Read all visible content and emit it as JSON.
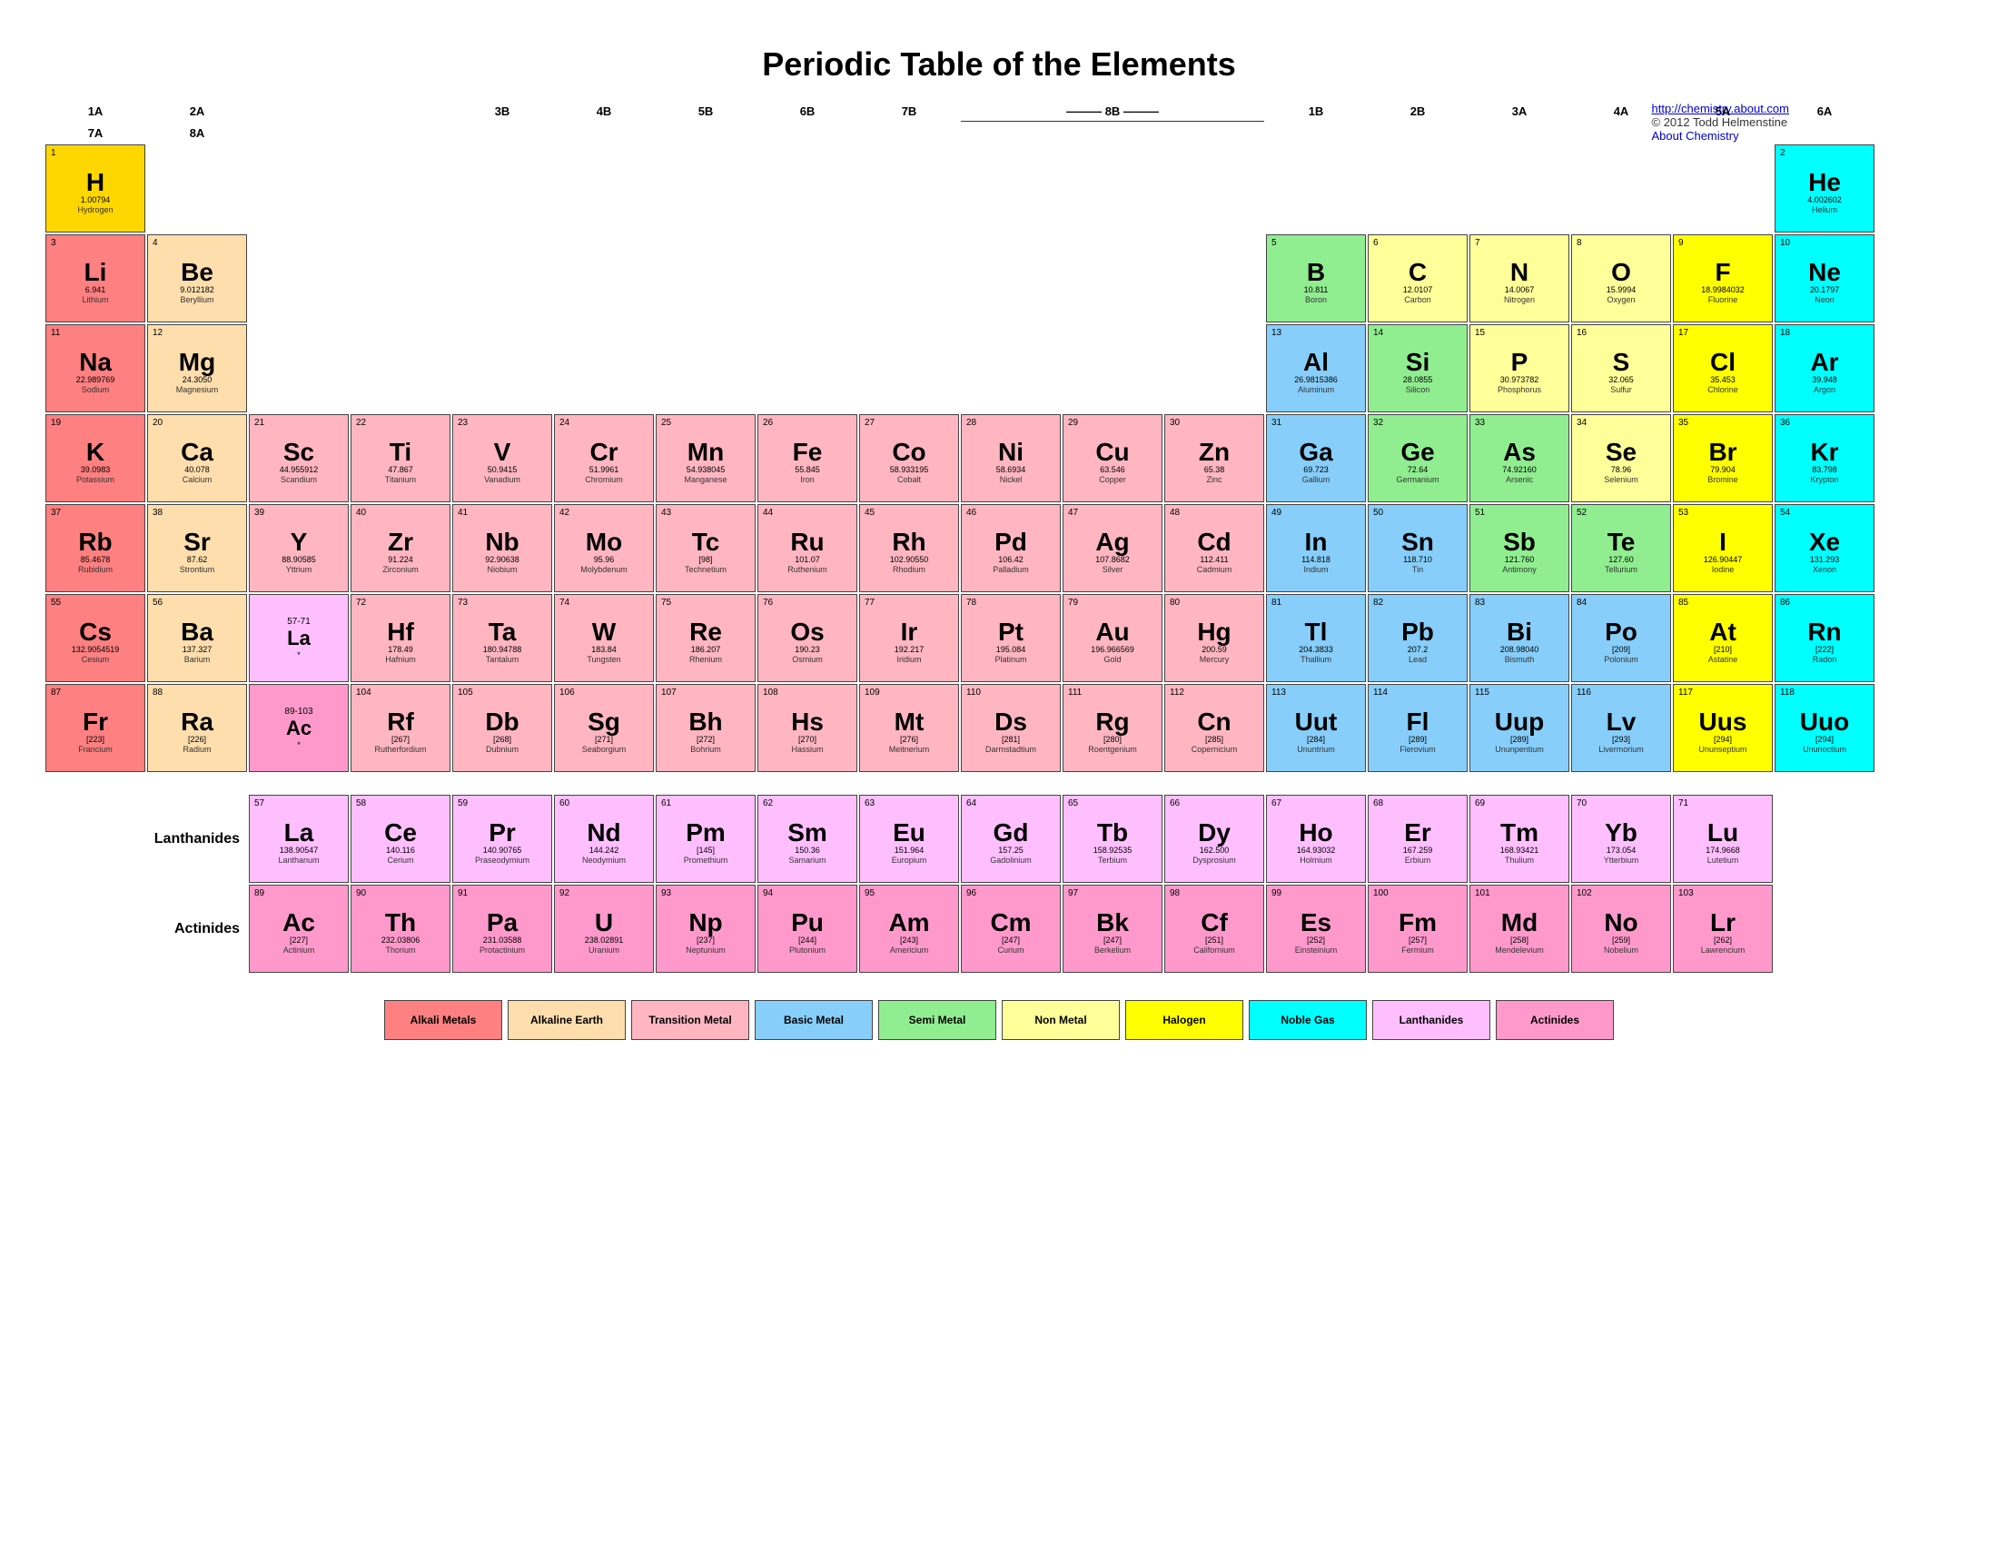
{
  "title": "Periodic Table of the Elements",
  "credit": {
    "url": "http://chemistry.about.com",
    "url_text": "http://chemistry.about.com",
    "copy": "© 2012 Todd Helmenstine",
    "site": "About Chemistry"
  },
  "col_headers": [
    "1A",
    "2A",
    "",
    "",
    "3B",
    "4B",
    "5B",
    "6B",
    "7B",
    "8B",
    "",
    "",
    "1B",
    "2B",
    "3A",
    "4A",
    "5A",
    "6A",
    "7A",
    "8A"
  ],
  "elements": [
    {
      "num": 1,
      "sym": "H",
      "mass": "1.00794",
      "name": "Hydrogen",
      "type": "hydrogen-cell",
      "row": 1,
      "col": 1
    },
    {
      "num": 2,
      "sym": "He",
      "mass": "4.002602",
      "name": "Helium",
      "type": "noble",
      "row": 1,
      "col": 18
    },
    {
      "num": 3,
      "sym": "Li",
      "mass": "6.941",
      "name": "Lithium",
      "type": "alkali",
      "row": 2,
      "col": 1
    },
    {
      "num": 4,
      "sym": "Be",
      "mass": "9.012182",
      "name": "Beryllium",
      "type": "alkaline",
      "row": 2,
      "col": 2
    },
    {
      "num": 5,
      "sym": "B",
      "mass": "10.811",
      "name": "Boron",
      "type": "semi",
      "row": 2,
      "col": 13
    },
    {
      "num": 6,
      "sym": "C",
      "mass": "12.0107",
      "name": "Carbon",
      "type": "nonmetal",
      "row": 2,
      "col": 14
    },
    {
      "num": 7,
      "sym": "N",
      "mass": "14.0067",
      "name": "Nitrogen",
      "type": "nonmetal",
      "row": 2,
      "col": 15
    },
    {
      "num": 8,
      "sym": "O",
      "mass": "15.9994",
      "name": "Oxygen",
      "type": "nonmetal",
      "row": 2,
      "col": 16
    },
    {
      "num": 9,
      "sym": "F",
      "mass": "18.9984032",
      "name": "Fluorine",
      "type": "halogen",
      "row": 2,
      "col": 17
    },
    {
      "num": 10,
      "sym": "Ne",
      "mass": "20.1797",
      "name": "Neon",
      "type": "noble",
      "row": 2,
      "col": 18
    },
    {
      "num": 11,
      "sym": "Na",
      "mass": "22.989769",
      "name": "Sodium",
      "type": "alkali",
      "row": 3,
      "col": 1
    },
    {
      "num": 12,
      "sym": "Mg",
      "mass": "24.3050",
      "name": "Magnesium",
      "type": "alkaline",
      "row": 3,
      "col": 2
    },
    {
      "num": 13,
      "sym": "Al",
      "mass": "26.9815386",
      "name": "Aluminum",
      "type": "basic-metal",
      "row": 3,
      "col": 13
    },
    {
      "num": 14,
      "sym": "Si",
      "mass": "28.0855",
      "name": "Silicon",
      "type": "semi",
      "row": 3,
      "col": 14
    },
    {
      "num": 15,
      "sym": "P",
      "mass": "30.973782",
      "name": "Phosphorus",
      "type": "nonmetal",
      "row": 3,
      "col": 15
    },
    {
      "num": 16,
      "sym": "S",
      "mass": "32.065",
      "name": "Sulfur",
      "type": "nonmetal",
      "row": 3,
      "col": 16
    },
    {
      "num": 17,
      "sym": "Cl",
      "mass": "35.453",
      "name": "Chlorine",
      "type": "halogen",
      "row": 3,
      "col": 17
    },
    {
      "num": 18,
      "sym": "Ar",
      "mass": "39.948",
      "name": "Argon",
      "type": "noble",
      "row": 3,
      "col": 18
    },
    {
      "num": 19,
      "sym": "K",
      "mass": "39.0983",
      "name": "Potassium",
      "type": "alkali",
      "row": 4,
      "col": 1
    },
    {
      "num": 20,
      "sym": "Ca",
      "mass": "40.078",
      "name": "Calcium",
      "type": "alkaline",
      "row": 4,
      "col": 2
    },
    {
      "num": 21,
      "sym": "Sc",
      "mass": "44.955912",
      "name": "Scandium",
      "type": "transition",
      "row": 4,
      "col": 3
    },
    {
      "num": 22,
      "sym": "Ti",
      "mass": "47.867",
      "name": "Titanium",
      "type": "transition",
      "row": 4,
      "col": 4
    },
    {
      "num": 23,
      "sym": "V",
      "mass": "50.9415",
      "name": "Vanadium",
      "type": "transition",
      "row": 4,
      "col": 5
    },
    {
      "num": 24,
      "sym": "Cr",
      "mass": "51.9961",
      "name": "Chromium",
      "type": "transition",
      "row": 4,
      "col": 6
    },
    {
      "num": 25,
      "sym": "Mn",
      "mass": "54.938045",
      "name": "Manganese",
      "type": "transition",
      "row": 4,
      "col": 7
    },
    {
      "num": 26,
      "sym": "Fe",
      "mass": "55.845",
      "name": "Iron",
      "type": "transition",
      "row": 4,
      "col": 8
    },
    {
      "num": 27,
      "sym": "Co",
      "mass": "58.933195",
      "name": "Cobalt",
      "type": "transition",
      "row": 4,
      "col": 9
    },
    {
      "num": 28,
      "sym": "Ni",
      "mass": "58.6934",
      "name": "Nickel",
      "type": "transition",
      "row": 4,
      "col": 10
    },
    {
      "num": 29,
      "sym": "Cu",
      "mass": "63.546",
      "name": "Copper",
      "type": "transition",
      "row": 4,
      "col": 11
    },
    {
      "num": 30,
      "sym": "Zn",
      "mass": "65.38",
      "name": "Zinc",
      "type": "transition",
      "row": 4,
      "col": 12
    },
    {
      "num": 31,
      "sym": "Ga",
      "mass": "69.723",
      "name": "Gallium",
      "type": "basic-metal",
      "row": 4,
      "col": 13
    },
    {
      "num": 32,
      "sym": "Ge",
      "mass": "72.64",
      "name": "Germanium",
      "type": "semi",
      "row": 4,
      "col": 14
    },
    {
      "num": 33,
      "sym": "As",
      "mass": "74.92160",
      "name": "Arsenic",
      "type": "semi",
      "row": 4,
      "col": 15
    },
    {
      "num": 34,
      "sym": "Se",
      "mass": "78.96",
      "name": "Selenium",
      "type": "nonmetal",
      "row": 4,
      "col": 16
    },
    {
      "num": 35,
      "sym": "Br",
      "mass": "79.904",
      "name": "Bromine",
      "type": "halogen",
      "row": 4,
      "col": 17
    },
    {
      "num": 36,
      "sym": "Kr",
      "mass": "83.798",
      "name": "Krypton",
      "type": "noble",
      "row": 4,
      "col": 18
    },
    {
      "num": 37,
      "sym": "Rb",
      "mass": "85.4678",
      "name": "Rubidium",
      "type": "alkali",
      "row": 5,
      "col": 1
    },
    {
      "num": 38,
      "sym": "Sr",
      "mass": "87.62",
      "name": "Strontium",
      "type": "alkaline",
      "row": 5,
      "col": 2
    },
    {
      "num": 39,
      "sym": "Y",
      "mass": "88.90585",
      "name": "Yttrium",
      "type": "transition",
      "row": 5,
      "col": 3
    },
    {
      "num": 40,
      "sym": "Zr",
      "mass": "91.224",
      "name": "Zirconium",
      "type": "transition",
      "row": 5,
      "col": 4
    },
    {
      "num": 41,
      "sym": "Nb",
      "mass": "92.90638",
      "name": "Niobium",
      "type": "transition",
      "row": 5,
      "col": 5
    },
    {
      "num": 42,
      "sym": "Mo",
      "mass": "95.96",
      "name": "Molybdenum",
      "type": "transition",
      "row": 5,
      "col": 6
    },
    {
      "num": 43,
      "sym": "Tc",
      "mass": "[98]",
      "name": "Technetium",
      "type": "transition",
      "row": 5,
      "col": 7
    },
    {
      "num": 44,
      "sym": "Ru",
      "mass": "101.07",
      "name": "Ruthenium",
      "type": "transition",
      "row": 5,
      "col": 8
    },
    {
      "num": 45,
      "sym": "Rh",
      "mass": "102.90550",
      "name": "Rhodium",
      "type": "transition",
      "row": 5,
      "col": 9
    },
    {
      "num": 46,
      "sym": "Pd",
      "mass": "106.42",
      "name": "Palladium",
      "type": "transition",
      "row": 5,
      "col": 10
    },
    {
      "num": 47,
      "sym": "Ag",
      "mass": "107.8682",
      "name": "Silver",
      "type": "transition",
      "row": 5,
      "col": 11
    },
    {
      "num": 48,
      "sym": "Cd",
      "mass": "112.411",
      "name": "Cadmium",
      "type": "transition",
      "row": 5,
      "col": 12
    },
    {
      "num": 49,
      "sym": "In",
      "mass": "114.818",
      "name": "Indium",
      "type": "basic-metal",
      "row": 5,
      "col": 13
    },
    {
      "num": 50,
      "sym": "Sn",
      "mass": "118.710",
      "name": "Tin",
      "type": "basic-metal",
      "row": 5,
      "col": 14
    },
    {
      "num": 51,
      "sym": "Sb",
      "mass": "121.760",
      "name": "Antimony",
      "type": "semi",
      "row": 5,
      "col": 15
    },
    {
      "num": 52,
      "sym": "Te",
      "mass": "127.60",
      "name": "Tellurium",
      "type": "semi",
      "row": 5,
      "col": 16
    },
    {
      "num": 53,
      "sym": "I",
      "mass": "126.90447",
      "name": "Iodine",
      "type": "halogen",
      "row": 5,
      "col": 17
    },
    {
      "num": 54,
      "sym": "Xe",
      "mass": "131.293",
      "name": "Xenon",
      "type": "noble",
      "row": 5,
      "col": 18
    },
    {
      "num": 55,
      "sym": "Cs",
      "mass": "132.9054519",
      "name": "Cesium",
      "type": "alkali",
      "row": 6,
      "col": 1
    },
    {
      "num": 56,
      "sym": "Ba",
      "mass": "137.327",
      "name": "Barium",
      "type": "alkaline",
      "row": 6,
      "col": 2
    },
    {
      "num": 57,
      "sym": "La*",
      "mass": "138.90547",
      "name": "Lanthanum",
      "type": "lanthanide",
      "row": 6,
      "col": 3,
      "note": "57-71"
    },
    {
      "num": 72,
      "sym": "Hf",
      "mass": "178.49",
      "name": "Hafnium",
      "type": "transition",
      "row": 6,
      "col": 4
    },
    {
      "num": 73,
      "sym": "Ta",
      "mass": "180.94788",
      "name": "Tantalum",
      "type": "transition",
      "row": 6,
      "col": 5
    },
    {
      "num": 74,
      "sym": "W",
      "mass": "183.84",
      "name": "Tungsten",
      "type": "transition",
      "row": 6,
      "col": 6
    },
    {
      "num": 75,
      "sym": "Re",
      "mass": "186.207",
      "name": "Rhenium",
      "type": "transition",
      "row": 6,
      "col": 7
    },
    {
      "num": 76,
      "sym": "Os",
      "mass": "190.23",
      "name": "Osmium",
      "type": "transition",
      "row": 6,
      "col": 8
    },
    {
      "num": 77,
      "sym": "Ir",
      "mass": "192.217",
      "name": "Iridium",
      "type": "transition",
      "row": 6,
      "col": 9
    },
    {
      "num": 78,
      "sym": "Pt",
      "mass": "195.084",
      "name": "Platinum",
      "type": "transition",
      "row": 6,
      "col": 10
    },
    {
      "num": 79,
      "sym": "Au",
      "mass": "196.966569",
      "name": "Gold",
      "type": "transition",
      "row": 6,
      "col": 11
    },
    {
      "num": 80,
      "sym": "Hg",
      "mass": "200.59",
      "name": "Mercury",
      "type": "transition",
      "row": 6,
      "col": 12
    },
    {
      "num": 81,
      "sym": "Tl",
      "mass": "204.3833",
      "name": "Thallium",
      "type": "basic-metal",
      "row": 6,
      "col": 13
    },
    {
      "num": 82,
      "sym": "Pb",
      "mass": "207.2",
      "name": "Lead",
      "type": "basic-metal",
      "row": 6,
      "col": 14
    },
    {
      "num": 83,
      "sym": "Bi",
      "mass": "208.98040",
      "name": "Bismuth",
      "type": "basic-metal",
      "row": 6,
      "col": 15
    },
    {
      "num": 84,
      "sym": "Po",
      "mass": "[209]",
      "name": "Polonium",
      "type": "basic-metal",
      "row": 6,
      "col": 16
    },
    {
      "num": 85,
      "sym": "At",
      "mass": "[210]",
      "name": "Astatine",
      "type": "halogen",
      "row": 6,
      "col": 17
    },
    {
      "num": 86,
      "sym": "Rn",
      "mass": "[222]",
      "name": "Radon",
      "type": "noble",
      "row": 6,
      "col": 18
    },
    {
      "num": 87,
      "sym": "Fr",
      "mass": "[223]",
      "name": "Francium",
      "type": "alkali",
      "row": 7,
      "col": 1
    },
    {
      "num": 88,
      "sym": "Ra",
      "mass": "[226]",
      "name": "Radium",
      "type": "alkaline",
      "row": 7,
      "col": 2
    },
    {
      "num": 89,
      "sym": "Ac*",
      "mass": "[227]",
      "name": "Actinium",
      "type": "actinide",
      "row": 7,
      "col": 3,
      "note": "89-103"
    },
    {
      "num": 104,
      "sym": "Rf",
      "mass": "[267]",
      "name": "Rutherfordium",
      "type": "transition",
      "row": 7,
      "col": 4
    },
    {
      "num": 105,
      "sym": "Db",
      "mass": "[268]",
      "name": "Dubnium",
      "type": "transition",
      "row": 7,
      "col": 5
    },
    {
      "num": 106,
      "sym": "Sg",
      "mass": "[271]",
      "name": "Seaborgium",
      "type": "transition",
      "row": 7,
      "col": 6
    },
    {
      "num": 107,
      "sym": "Bh",
      "mass": "[272]",
      "name": "Bohrium",
      "type": "transition",
      "row": 7,
      "col": 7
    },
    {
      "num": 108,
      "sym": "Hs",
      "mass": "[270]",
      "name": "Hassium",
      "type": "transition",
      "row": 7,
      "col": 8
    },
    {
      "num": 109,
      "sym": "Mt",
      "mass": "[276]",
      "name": "Meitnerium",
      "type": "transition",
      "row": 7,
      "col": 9
    },
    {
      "num": 110,
      "sym": "Ds",
      "mass": "[281]",
      "name": "Darmstadtium",
      "type": "transition",
      "row": 7,
      "col": 10
    },
    {
      "num": 111,
      "sym": "Rg",
      "mass": "[280]",
      "name": "Roentgenium",
      "type": "transition",
      "row": 7,
      "col": 11
    },
    {
      "num": 112,
      "sym": "Cn",
      "mass": "[285]",
      "name": "Copernicium",
      "type": "transition",
      "row": 7,
      "col": 12
    },
    {
      "num": 113,
      "sym": "Uut",
      "mass": "[284]",
      "name": "Ununtrium",
      "type": "basic-metal",
      "row": 7,
      "col": 13
    },
    {
      "num": 114,
      "sym": "Fl",
      "mass": "[289]",
      "name": "Flerovium",
      "type": "basic-metal",
      "row": 7,
      "col": 14
    },
    {
      "num": 115,
      "sym": "Uup",
      "mass": "[289]",
      "name": "Ununpentium",
      "type": "basic-metal",
      "row": 7,
      "col": 15
    },
    {
      "num": 116,
      "sym": "Lv",
      "mass": "[293]",
      "name": "Livermorium",
      "type": "basic-metal",
      "row": 7,
      "col": 16
    },
    {
      "num": 117,
      "sym": "Uus",
      "mass": "[294]",
      "name": "Ununseptium",
      "type": "halogen",
      "row": 7,
      "col": 17
    },
    {
      "num": 118,
      "sym": "Uuo",
      "mass": "[294]",
      "name": "Ununoctium",
      "type": "noble",
      "row": 7,
      "col": 18
    }
  ],
  "lanthanides": [
    {
      "num": 57,
      "sym": "La",
      "mass": "138.90547",
      "name": "Lanthanum"
    },
    {
      "num": 58,
      "sym": "Ce",
      "mass": "140.116",
      "name": "Cerium"
    },
    {
      "num": 59,
      "sym": "Pr",
      "mass": "140.90765",
      "name": "Praseodymium"
    },
    {
      "num": 60,
      "sym": "Nd",
      "mass": "144.242",
      "name": "Neodymium"
    },
    {
      "num": 61,
      "sym": "Pm",
      "mass": "[145]",
      "name": "Promethium"
    },
    {
      "num": 62,
      "sym": "Sm",
      "mass": "150.36",
      "name": "Samarium"
    },
    {
      "num": 63,
      "sym": "Eu",
      "mass": "151.964",
      "name": "Europium"
    },
    {
      "num": 64,
      "sym": "Gd",
      "mass": "157.25",
      "name": "Gadolinium"
    },
    {
      "num": 65,
      "sym": "Tb",
      "mass": "158.92535",
      "name": "Terbium"
    },
    {
      "num": 66,
      "sym": "Dy",
      "mass": "162.500",
      "name": "Dysprosium"
    },
    {
      "num": 67,
      "sym": "Ho",
      "mass": "164.93032",
      "name": "Holmium"
    },
    {
      "num": 68,
      "sym": "Er",
      "mass": "167.259",
      "name": "Erbium"
    },
    {
      "num": 69,
      "sym": "Tm",
      "mass": "168.93421",
      "name": "Thulium"
    },
    {
      "num": 70,
      "sym": "Yb",
      "mass": "173.054",
      "name": "Ytterbium"
    },
    {
      "num": 71,
      "sym": "Lu",
      "mass": "174.9668",
      "name": "Lutetium"
    }
  ],
  "actinides": [
    {
      "num": 89,
      "sym": "Ac",
      "mass": "[227]",
      "name": "Actinium"
    },
    {
      "num": 90,
      "sym": "Th",
      "mass": "232.03806",
      "name": "Thorium"
    },
    {
      "num": 91,
      "sym": "Pa",
      "mass": "231.03588",
      "name": "Protactinium"
    },
    {
      "num": 92,
      "sym": "U",
      "mass": "238.02891",
      "name": "Uranium"
    },
    {
      "num": 93,
      "sym": "Np",
      "mass": "[237]",
      "name": "Neptunium"
    },
    {
      "num": 94,
      "sym": "Pu",
      "mass": "[244]",
      "name": "Plutonium"
    },
    {
      "num": 95,
      "sym": "Am",
      "mass": "[243]",
      "name": "Americium"
    },
    {
      "num": 96,
      "sym": "Cm",
      "mass": "[247]",
      "name": "Curium"
    },
    {
      "num": 97,
      "sym": "Bk",
      "mass": "[247]",
      "name": "Berkelium"
    },
    {
      "num": 98,
      "sym": "Cf",
      "mass": "[251]",
      "name": "Californium"
    },
    {
      "num": 99,
      "sym": "Es",
      "mass": "[252]",
      "name": "Einsteinium"
    },
    {
      "num": 100,
      "sym": "Fm",
      "mass": "[257]",
      "name": "Fermium"
    },
    {
      "num": 101,
      "sym": "Md",
      "mass": "[258]",
      "name": "Mendelevium"
    },
    {
      "num": 102,
      "sym": "No",
      "mass": "[259]",
      "name": "Nobelium"
    },
    {
      "num": 103,
      "sym": "Lr",
      "mass": "[262]",
      "name": "Lawrencium"
    }
  ],
  "legend": [
    {
      "label": "Alkali Metals",
      "color": "#FF8080"
    },
    {
      "label": "Alkaline Earth",
      "color": "#FFDEAD"
    },
    {
      "label": "Transition Metal",
      "color": "#FFB6C1"
    },
    {
      "label": "Basic Metal",
      "color": "#87CEFA"
    },
    {
      "label": "Semi Metal",
      "color": "#90EE90"
    },
    {
      "label": "Non Metal",
      "color": "#FFFF99"
    },
    {
      "label": "Halogen",
      "color": "#FFFF00"
    },
    {
      "label": "Noble Gas",
      "color": "#00FFFF"
    },
    {
      "label": "Lanthanides",
      "color": "#FFBFFF"
    },
    {
      "label": "Actinides",
      "color": "#FF99CC"
    }
  ]
}
